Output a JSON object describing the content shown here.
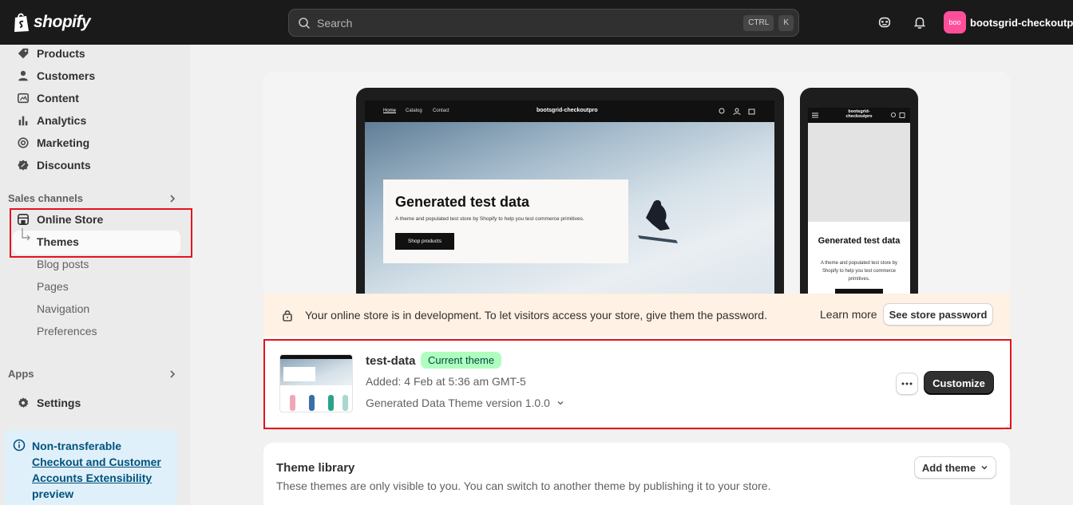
{
  "topbar": {
    "logo_text": "shopify",
    "search_placeholder": "Search",
    "kbd_ctrl": "CTRL",
    "kbd_k": "K",
    "store_avatar": "boo",
    "store_name": "bootsgrid-checkoutpro"
  },
  "sidebar": {
    "items": [
      {
        "label": "Products",
        "icon": "tag-icon"
      },
      {
        "label": "Customers",
        "icon": "person-icon"
      },
      {
        "label": "Content",
        "icon": "content-icon"
      },
      {
        "label": "Analytics",
        "icon": "bar-chart-icon"
      },
      {
        "label": "Marketing",
        "icon": "target-icon"
      },
      {
        "label": "Discounts",
        "icon": "discount-icon"
      }
    ],
    "sales_channels_label": "Sales channels",
    "online_store_label": "Online Store",
    "themes_label": "Themes",
    "sub_items": [
      "Blog posts",
      "Pages",
      "Navigation",
      "Preferences"
    ],
    "apps_label": "Apps",
    "settings_label": "Settings",
    "notice": {
      "title": "Non-transferable",
      "link": "Checkout and Customer Accounts Extensibility",
      "tail": "preview"
    }
  },
  "preview": {
    "nav_links": [
      "Home",
      "Catalog",
      "Contact"
    ],
    "store_title": "bootsgrid-checkoutpro",
    "phone_store_title": "bootsgrid-checkoutpro",
    "hero_heading": "Generated test data",
    "hero_text": "A theme and populated test store by Shopify to help you test commerce primitives.",
    "hero_button": "Shop products",
    "phone_text": "A theme and populated test store by Shopify to help you test commerce primitives."
  },
  "dev_banner": {
    "message": "Your online store is in development. To let visitors access your store, give them the password.",
    "learn_more": "Learn more",
    "button": "See store password"
  },
  "current_theme": {
    "name": "test-data",
    "badge": "Current theme",
    "added": "Added: 4 Feb at 5:36 am GMT-5",
    "version": "Generated Data Theme version 1.0.0",
    "customize_button": "Customize"
  },
  "theme_library": {
    "title": "Theme library",
    "subtitle": "These themes are only visible to you. You can switch to another theme by publishing it to your store.",
    "add_button": "Add theme"
  },
  "colors": {
    "topbar": "#1a1a1a",
    "highlight": "#e5121b",
    "badge_bg": "#affebf",
    "dev_banner_bg": "#fff1e3",
    "notice_bg": "#e0f0fa"
  }
}
